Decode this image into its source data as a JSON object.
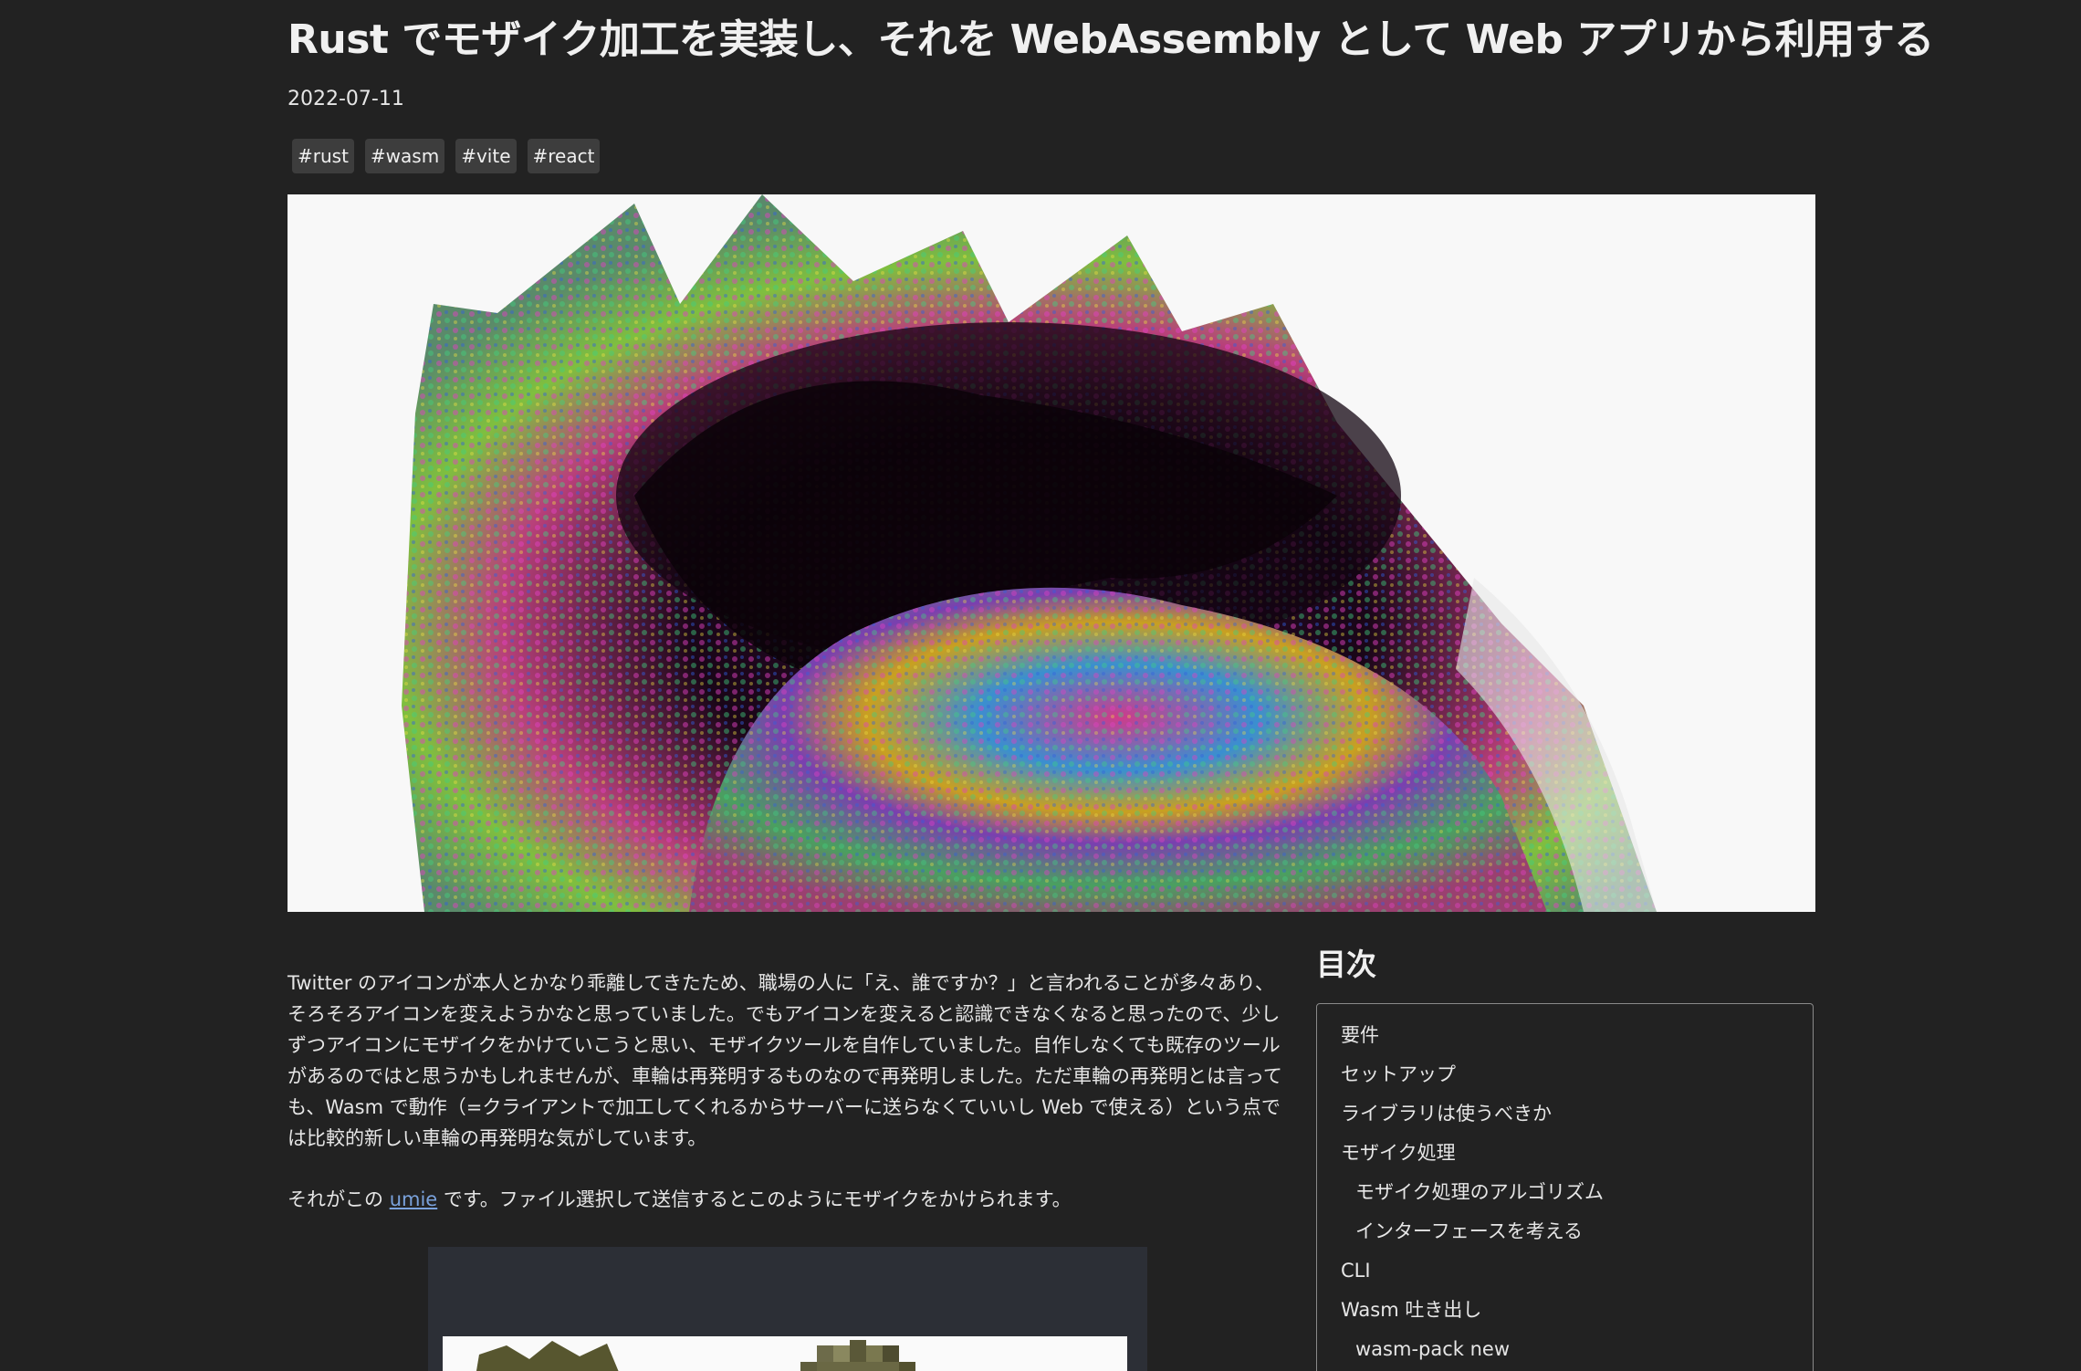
{
  "post": {
    "title": "Rust でモザイク加工を実装し、それを WebAssembly として Web アプリから利用する",
    "date": "2022-07-11",
    "tags": [
      "#rust",
      "#wasm",
      "#vite",
      "#react"
    ]
  },
  "article": {
    "paragraph1": "Twitter のアイコンが本人とかなり乖離してきたため、職場の人に「え、誰ですか？」と言われることが多々あり、そろそろアイコンを変えようかなと思っていました。でもアイコンを変えると認識できなくなると思ったので、少しずつアイコンにモザイクをかけていこうと思い、モザイクツールを自作していました。自作しなくても既存のツールがあるのではと思うかもしれませんが、車輪は再発明するものなので再発明しました。ただ車輪の再発明とは言っても、Wasm で動作（=クライアントで加工してくれるからサーバーに送らなくていいし Web で使える）という点では比較的新しい車輪の再発明な気がしています。",
    "paragraph2_before": "それがこの ",
    "paragraph2_link": "umie",
    "paragraph2_after": " です。ファイル選択して送信するとこのようにモザイクをかけられます。"
  },
  "toc": {
    "heading": "目次",
    "items": [
      {
        "label": "要件",
        "level": 1
      },
      {
        "label": "セットアップ",
        "level": 1
      },
      {
        "label": "ライブラリは使うべきか",
        "level": 1
      },
      {
        "label": "モザイク処理",
        "level": 1
      },
      {
        "label": "モザイク処理のアルゴリズム",
        "level": 2
      },
      {
        "label": "インターフェースを考える",
        "level": 2
      },
      {
        "label": "CLI",
        "level": 1
      },
      {
        "label": "Wasm 吐き出し",
        "level": 1
      },
      {
        "label": "wasm-pack new",
        "level": 2
      }
    ]
  }
}
